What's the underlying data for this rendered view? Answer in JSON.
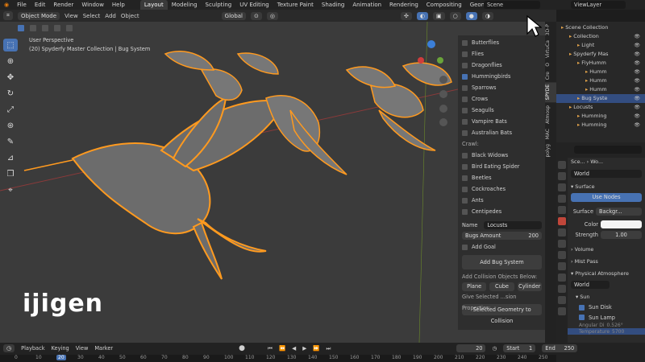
{
  "menu": [
    "File",
    "Edit",
    "Render",
    "Window",
    "Help"
  ],
  "workspaces": [
    "Layout",
    "Modeling",
    "Sculpting",
    "UV Editing",
    "Texture Paint",
    "Shading",
    "Animation",
    "Rendering",
    "Compositing",
    "Geometry Nodes"
  ],
  "active_workspace": "Layout",
  "scene_field": "Scene",
  "viewlayer_field": "ViewLayer",
  "header": {
    "mode": "Object Mode",
    "items": [
      "View",
      "Select",
      "Add",
      "Object"
    ],
    "transform": "Global"
  },
  "viewport": {
    "perspective": "User Perspective",
    "collection": "(20) Spyderfy Master Collection | Bug System",
    "watermark": "ijigen"
  },
  "npanel": {
    "fly_items": [
      {
        "label": "Butterflies",
        "on": false
      },
      {
        "label": "Flies",
        "on": false
      },
      {
        "label": "Dragonflies",
        "on": false
      },
      {
        "label": "Hummingbirds",
        "on": true
      },
      {
        "label": "Sparrows",
        "on": false
      },
      {
        "label": "Crows",
        "on": false
      },
      {
        "label": "Seagulls",
        "on": false
      },
      {
        "label": "Vampire Bats",
        "on": false
      },
      {
        "label": "Australian Bats",
        "on": false
      }
    ],
    "crawl_label": "Crawl:",
    "crawl_items": [
      {
        "label": "Black Widows",
        "on": false
      },
      {
        "label": "Bird Eating Spider",
        "on": false
      },
      {
        "label": "Beetles",
        "on": false
      },
      {
        "label": "Cockroaches",
        "on": false
      },
      {
        "label": "Ants",
        "on": false
      },
      {
        "label": "Centipedes",
        "on": false
      }
    ],
    "name_label": "Name",
    "name_value": "Locusts",
    "amount_label": "Bugs Amount",
    "amount_value": "200",
    "add_goal": "Add Goal",
    "add_bug_system": "Add Bug System",
    "collision_label": "Add Collision Objects Below:",
    "collision_buttons": [
      "Plane",
      "Cube",
      "Cylinder"
    ],
    "give_selected": "Give Selected ...sion Properties:",
    "selected_geo": "Selected Geometry to Collision"
  },
  "vtabs": [
    "3D-P",
    "VirtuCa",
    "O",
    "Cre",
    "SPYDE",
    "Atmosp",
    "MAC",
    "polyg"
  ],
  "outliner": {
    "rows": [
      {
        "label": "Scene Collection",
        "indent": 0,
        "sel": false
      },
      {
        "label": "Collection",
        "indent": 1,
        "sel": false
      },
      {
        "label": "Light",
        "indent": 2,
        "sel": false
      },
      {
        "label": "Spyderfy Mas",
        "indent": 1,
        "sel": false
      },
      {
        "label": "FlyHumm",
        "indent": 2,
        "sel": false
      },
      {
        "label": "Humm",
        "indent": 3,
        "sel": false
      },
      {
        "label": "Humm",
        "indent": 3,
        "sel": false
      },
      {
        "label": "Humm",
        "indent": 3,
        "sel": false
      },
      {
        "label": "Bug Syste",
        "indent": 2,
        "sel": true
      },
      {
        "label": "Locusts",
        "indent": 1,
        "sel": false
      },
      {
        "label": "Humming",
        "indent": 2,
        "sel": false
      },
      {
        "label": "Humming",
        "indent": 2,
        "sel": false
      }
    ]
  },
  "props": {
    "crumb1": "Sce...",
    "crumb2": "Wo...",
    "world_name": "World",
    "surface_header": "Surface",
    "use_nodes": "Use Nodes",
    "surface_label": "Surface",
    "surface_value": "Backgr...",
    "color_label": "Color",
    "strength_label": "Strength",
    "strength_value": "1.00",
    "volume": "Volume",
    "mist": "Mist Pass",
    "phys_atmo": "Physical Atmosphere",
    "world2": "World",
    "sun": "Sun",
    "sun_disk": "Sun Disk",
    "sun_lamp": "Sun Lamp",
    "angular": "Angular Di",
    "angular_val": "0.526°",
    "temp": "Temperature",
    "temp_val": "5700"
  },
  "timeline": {
    "menus": [
      "Playback",
      "Keying",
      "View",
      "Marker"
    ],
    "current": "20",
    "start_label": "Start",
    "start": "1",
    "end_label": "End",
    "end": "250",
    "ticks": [
      "0",
      "10",
      "20",
      "30",
      "40",
      "50",
      "60",
      "70",
      "80",
      "90",
      "100",
      "110",
      "120",
      "130",
      "140",
      "150",
      "160",
      "170",
      "180",
      "190",
      "200",
      "210",
      "220",
      "230",
      "240",
      "250"
    ]
  },
  "colors": {
    "accent": "#4772b3",
    "selection_orange": "#ff9a1f"
  }
}
